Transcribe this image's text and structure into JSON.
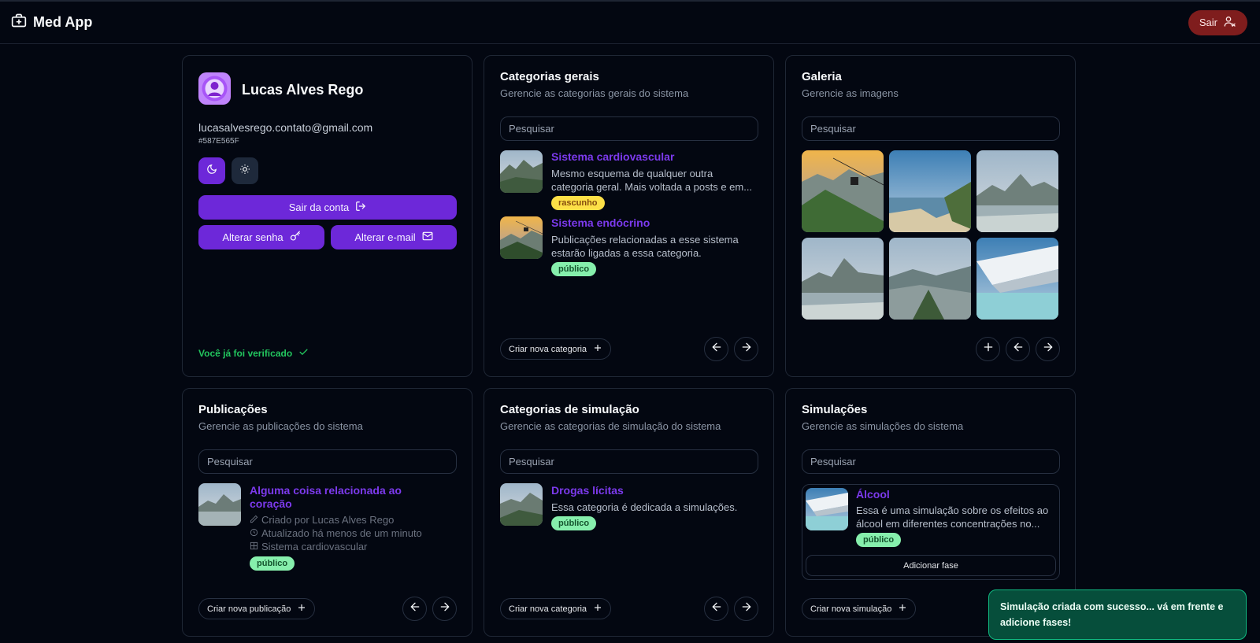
{
  "app": {
    "title": "Med App",
    "logout_label": "Sair"
  },
  "profile": {
    "name": "Lucas Alves Rego",
    "email": "lucasalvesrego.contato@gmail.com",
    "id": "#587E565F",
    "logout_account_label": "Sair da conta",
    "change_password_label": "Alterar senha",
    "change_email_label": "Alterar e-mail",
    "verified_label": "Você já foi verificado"
  },
  "general_categories": {
    "title": "Categorias gerais",
    "subtitle": "Gerencie as categorias gerais do sistema",
    "search_placeholder": "Pesquisar",
    "items": [
      {
        "title": "Sistema cardiovascular",
        "desc1": "Mesmo esquema de qualquer outra",
        "desc2": "categoria geral. Mais voltada a posts e em...",
        "status": "rascunho"
      },
      {
        "title": "Sistema endócrino",
        "desc1": "Publicações relacionadas a esse sistema",
        "desc2": "estarão ligadas a essa categoria.",
        "status": "público"
      }
    ],
    "create_label": "Criar nova categoria"
  },
  "gallery": {
    "title": "Galeria",
    "subtitle": "Gerencie as imagens",
    "search_placeholder": "Pesquisar"
  },
  "publications": {
    "title": "Publicações",
    "subtitle": "Gerencie as publicações do sistema",
    "search_placeholder": "Pesquisar",
    "item": {
      "title_line1": "Alguma coisa relacionada ao",
      "title_line2": "coração",
      "created_by": "Criado por Lucas Alves Rego",
      "updated": "Atualizado há menos de um minuto",
      "category": "Sistema cardiovascular",
      "status": "público"
    },
    "create_label": "Criar nova publicação"
  },
  "simulation_categories": {
    "title": "Categorias de simulação",
    "subtitle": "Gerencie as categorias de simulação do sistema",
    "search_placeholder": "Pesquisar",
    "item": {
      "title": "Drogas lícitas",
      "desc": "Essa categoria é dedicada a simulações.",
      "status": "público"
    },
    "create_label": "Criar nova categoria"
  },
  "simulations": {
    "title": "Simulações",
    "subtitle": "Gerencie as simulações do sistema",
    "search_placeholder": "Pesquisar",
    "item": {
      "title": "Álcool",
      "desc1": "Essa é uma simulação sobre os efeitos ao",
      "desc2": "álcool em diferentes concentrações no...",
      "status": "público",
      "add_phase_label": "Adicionar fase"
    },
    "create_label": "Criar nova simulação"
  },
  "toast": {
    "line1": "Simulação criada com sucesso... vá em frente e",
    "line2": "adicione fases!"
  },
  "colors": {
    "accent": "#6d28d9",
    "link": "#7c3aed",
    "danger": "#7f1d1d",
    "success": "#22c55e",
    "background": "#030711"
  }
}
